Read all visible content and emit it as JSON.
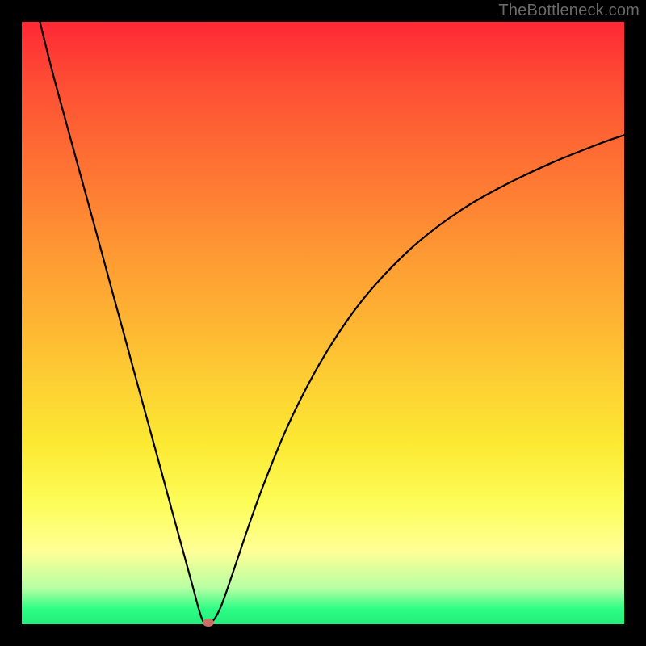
{
  "watermark": "TheBottleneck.com",
  "chart_data": {
    "type": "line",
    "title": "",
    "xlabel": "",
    "ylabel": "",
    "xlim": [
      0,
      100
    ],
    "ylim": [
      0,
      100
    ],
    "grid": false,
    "legend": false,
    "colors": {
      "gradient_top": "#fe2834",
      "gradient_bottom": "#25ec7d",
      "curve": "#000000",
      "marker": "#cb6e64"
    },
    "series": [
      {
        "name": "bottleneck-curve",
        "x": [
          3,
          5,
          7,
          9,
          11,
          13,
          15,
          17,
          19,
          21,
          23,
          25,
          27,
          28.5,
          29.5,
          30.2,
          31,
          32,
          33,
          34,
          36,
          38,
          40,
          43,
          46,
          50,
          55,
          60,
          66,
          73,
          80,
          88,
          96,
          100
        ],
        "values": [
          100,
          92,
          84.6,
          77.3,
          70,
          62.7,
          55.3,
          48,
          40.6,
          33.3,
          26,
          18.6,
          11.3,
          5.8,
          2.1,
          0.3,
          0,
          0.9,
          2.8,
          5.5,
          11.4,
          17.3,
          22.8,
          30.3,
          36.8,
          44.2,
          51.8,
          57.8,
          63.6,
          68.8,
          72.8,
          76.6,
          79.8,
          81.2
        ]
      }
    ],
    "optimal_point": {
      "x": 31,
      "y": 0
    }
  }
}
